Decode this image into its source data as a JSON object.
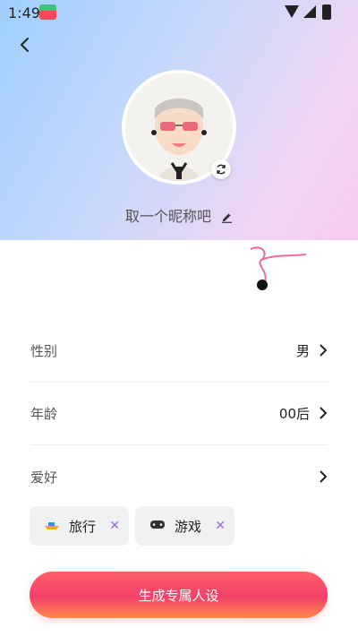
{
  "status_bar": {
    "time": "1:49"
  },
  "profile": {
    "nickname_placeholder": "取一个昵称吧"
  },
  "fields": [
    {
      "label": "性别",
      "value": "男"
    },
    {
      "label": "年龄",
      "value": "00后"
    },
    {
      "label": "爱好",
      "value": ""
    }
  ],
  "hobbies": [
    {
      "label": "旅行",
      "icon": "boat-icon"
    },
    {
      "label": "游戏",
      "icon": "gamepad-icon"
    }
  ],
  "actions": {
    "generate_label": "生成专属人设"
  },
  "colors": {
    "accent_start": "#ff5f6a",
    "accent_end": "#ff8a4a",
    "remove_x": "#9b6bd6"
  }
}
